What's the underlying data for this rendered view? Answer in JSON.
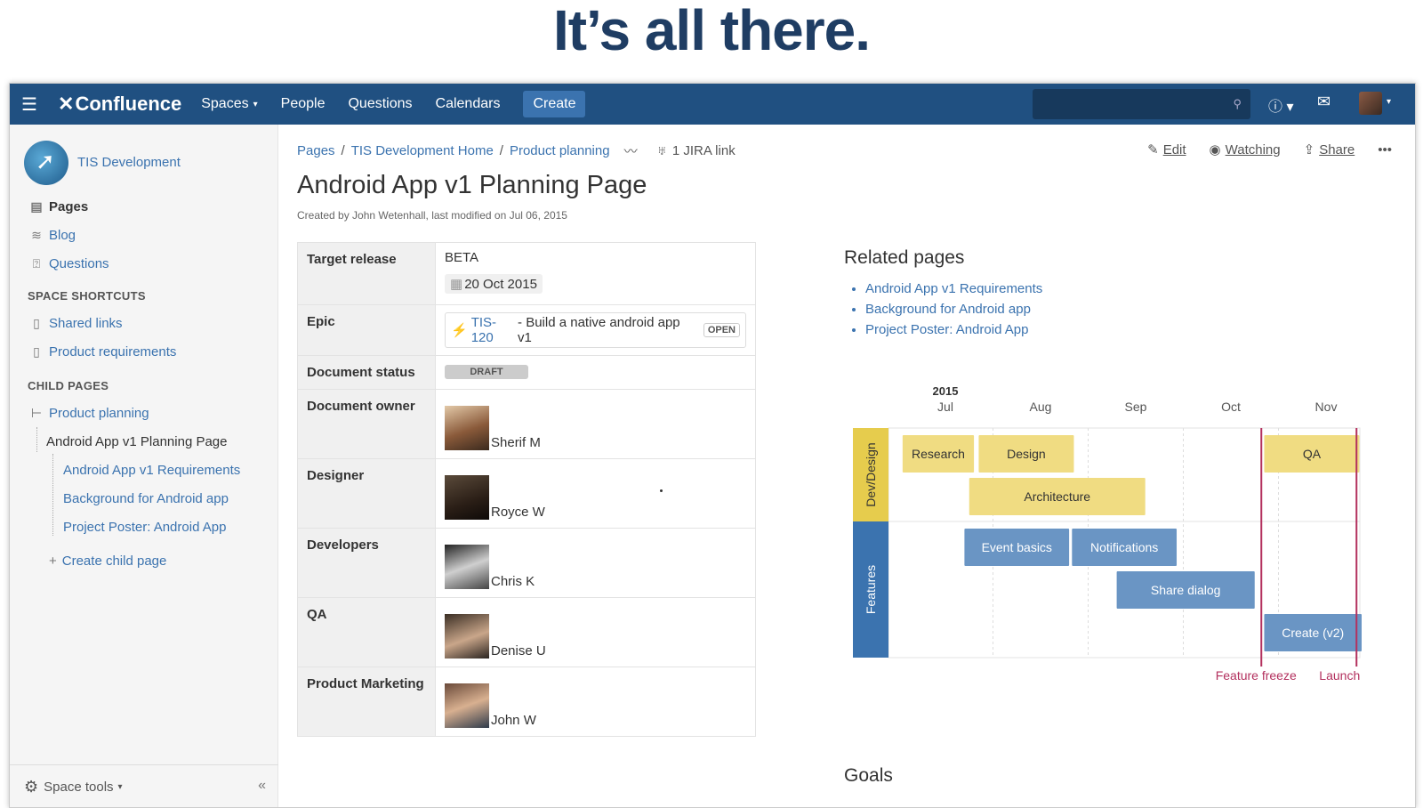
{
  "headline": "It’s all there.",
  "topnav": {
    "logo": "Confluence",
    "items": [
      "Spaces",
      "People",
      "Questions",
      "Calendars"
    ],
    "create": "Create"
  },
  "sidebar": {
    "space_name": "TIS Development",
    "nav": [
      "Pages",
      "Blog",
      "Questions"
    ],
    "shortcuts_head": "SPACE SHORTCUTS",
    "shortcuts": [
      "Shared links",
      "Product requirements"
    ],
    "child_head": "CHILD PAGES",
    "children": {
      "parent": "Product planning",
      "current": "Android App v1 Planning Page",
      "grandchildren": [
        "Android App v1 Requirements",
        "Background for Android app",
        "Project Poster: Android App"
      ],
      "create": "Create child page"
    },
    "footer": "Space tools"
  },
  "breadcrumb": [
    "Pages",
    "TIS Development Home",
    "Product planning"
  ],
  "jira_link": "1 JIRA link",
  "actions": {
    "edit": "Edit",
    "watching": "Watching",
    "share": "Share",
    "more": "•••"
  },
  "page": {
    "title": "Android App v1 Planning Page",
    "byline": "Created by John Wetenhall, last modified on Jul 06, 2015"
  },
  "props": {
    "target_release_label": "Target release",
    "target_release": "BETA",
    "target_date": "20 Oct 2015",
    "epic_label": "Epic",
    "epic_key": "TIS-120",
    "epic_summary": " - Build a native android app v1",
    "epic_status": "OPEN",
    "status_label": "Document status",
    "status": "DRAFT",
    "owner_label": "Document owner",
    "owner": "Sherif M",
    "designer_label": "Designer",
    "designer": "Royce W",
    "developers_label": "Developers",
    "developers": "Chris K",
    "qa_label": "QA",
    "qa": "Denise U",
    "marketing_label": "Product Marketing",
    "marketing": "John W"
  },
  "related": {
    "title": "Related pages",
    "links": [
      "Android App v1 Requirements",
      "Background for Android app",
      "Project Poster: Android App"
    ]
  },
  "chart_data": {
    "type": "gantt",
    "year_label": "2015",
    "months": [
      "Jul",
      "Aug",
      "Sep",
      "Oct",
      "Nov"
    ],
    "lanes": [
      {
        "name": "Dev/Design",
        "color": "#e6cc4d"
      },
      {
        "name": "Features",
        "color": "#3b73af"
      }
    ],
    "tasks": [
      {
        "name": "Research",
        "lane": 0,
        "start": -0.45,
        "end": 0.3,
        "row": 0
      },
      {
        "name": "Design",
        "lane": 0,
        "start": 0.35,
        "end": 1.35,
        "row": 0
      },
      {
        "name": "Architecture",
        "lane": 0,
        "start": 0.25,
        "end": 2.1,
        "row": 1
      },
      {
        "name": "QA",
        "lane": 0,
        "start": 3.35,
        "end": 4.35,
        "row": 0
      },
      {
        "name": "Event basics",
        "lane": 1,
        "start": 0.2,
        "end": 1.3,
        "row": 0
      },
      {
        "name": "Notifications",
        "lane": 1,
        "start": 1.33,
        "end": 2.43,
        "row": 0
      },
      {
        "name": "Share dialog",
        "lane": 1,
        "start": 1.8,
        "end": 3.25,
        "row": 1
      },
      {
        "name": "Create (v2)",
        "lane": 1,
        "start": 3.35,
        "end": 4.4,
        "row": 2
      }
    ],
    "markers": [
      {
        "name": "Feature freeze",
        "at": 3.32
      },
      {
        "name": "Launch",
        "at": 4.32
      }
    ],
    "bar_colors": {
      "design": "#f0dc82",
      "features": "#6a95c4",
      "marker": "#b3305e"
    }
  },
  "goals_title": "Goals"
}
